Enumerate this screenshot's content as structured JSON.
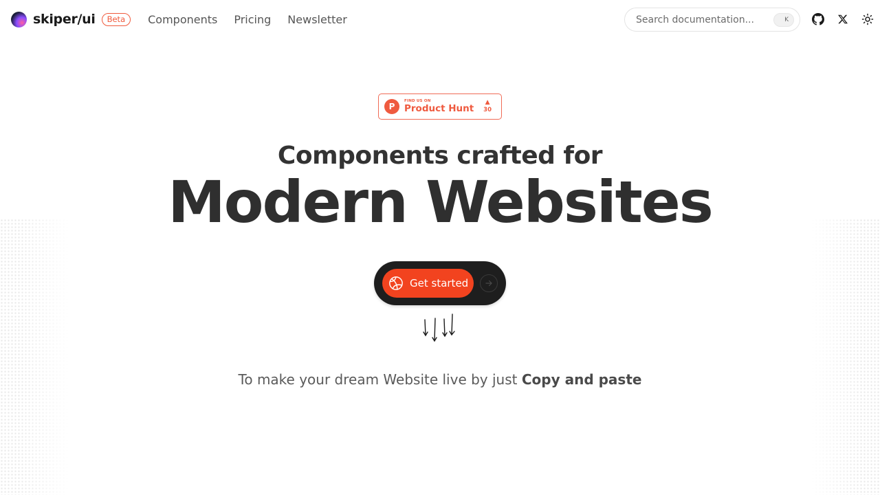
{
  "header": {
    "logo_text": "skiper/ui",
    "beta_label": "Beta",
    "nav": [
      {
        "label": "Components"
      },
      {
        "label": "Pricing"
      },
      {
        "label": "Newsletter"
      }
    ],
    "search": {
      "placeholder": "Search documentation...",
      "shortcut": "K"
    },
    "icons": [
      "github-icon",
      "x-icon",
      "sun-icon"
    ]
  },
  "badge": {
    "small_text": "FIND US ON",
    "big_text": "Product Hunt",
    "logo_letter": "P",
    "arrow": "▲",
    "votes": "30"
  },
  "hero": {
    "subtitle": "Components crafted for",
    "title": "Modern Websites"
  },
  "cta": {
    "label": "Get started",
    "icons": [
      "globe-icon",
      "arrow-right-icon"
    ]
  },
  "tagline": {
    "text": "To make your dream Website live by just ",
    "emphasis": "Copy and paste"
  },
  "colors": {
    "accent": "#f2431f",
    "badge": "#ef5a3f",
    "dark": "#1e1e1e",
    "text": "#2f2f2f"
  }
}
